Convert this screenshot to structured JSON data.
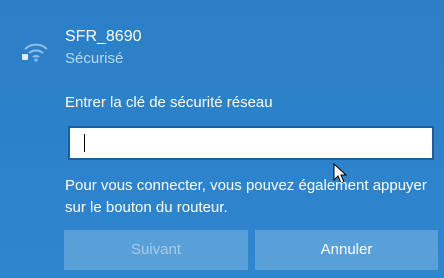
{
  "network": {
    "name": "SFR_8690",
    "status": "Sécurisé",
    "icon": "wifi-secured-icon"
  },
  "form": {
    "prompt": "Entrer la clé de sécurité réseau",
    "key_value": "",
    "hint": "Pour vous connecter, vous pouvez également appuyer sur le bouton du routeur."
  },
  "buttons": {
    "next_label": "Suivant",
    "cancel_label": "Annuler"
  },
  "colors": {
    "panel_background": "#2f86ce",
    "button_background": "#5aa0d8",
    "disabled_text": "#a6cbe9",
    "status_text": "#b9d8f2"
  }
}
